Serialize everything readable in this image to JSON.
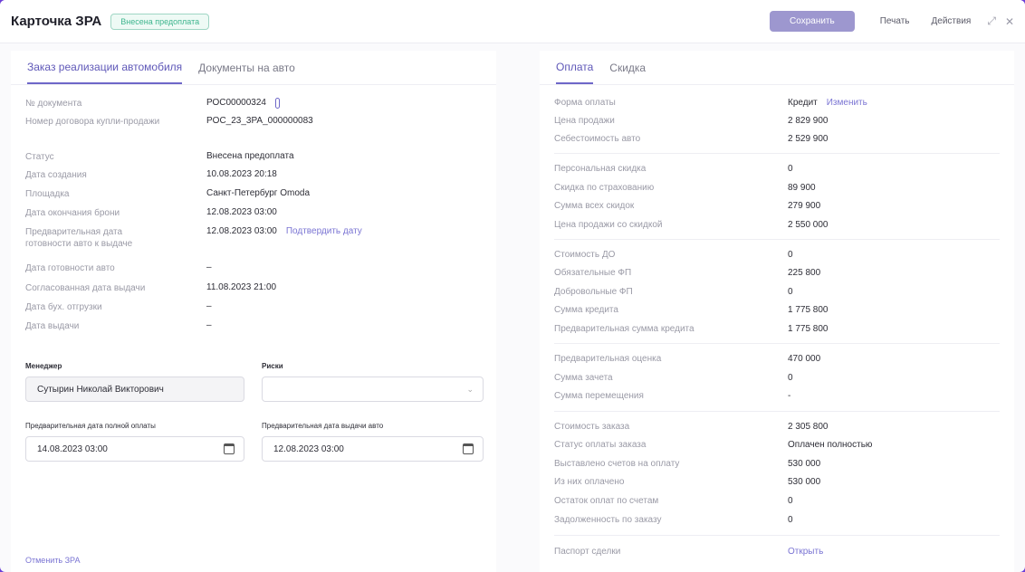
{
  "header": {
    "title": "Карточка ЗРА",
    "status_badge": "Внесена предоплата",
    "save_label": "Сохранить",
    "print_label": "Печать",
    "actions_label": "Действия"
  },
  "left": {
    "tabs": [
      {
        "label": "Заказ реализации автомобиля"
      },
      {
        "label": "Документы на авто"
      }
    ],
    "fields": {
      "doc_no": {
        "label": "№ документа",
        "value": "РОС00000324"
      },
      "contract_no": {
        "label": "Номер договора купли-продажи",
        "value": "POC_23_3PA_000000083"
      },
      "status": {
        "label": "Статус",
        "value": "Внесена предоплата"
      },
      "created": {
        "label": "Дата создания",
        "value": "10.08.2023 20:18"
      },
      "site": {
        "label": "Площадка",
        "value": "Санкт-Петербург Omoda"
      },
      "reserve_end": {
        "label": "Дата окончания брони",
        "value": "12.08.2023 03:00"
      },
      "prelim_ready": {
        "label": "Предварительная дата готовности авто к выдаче",
        "value": "12.08.2023 03:00",
        "link": "Подтвердить дату"
      },
      "ready": {
        "label": "Дата готовности авто",
        "value": "–"
      },
      "agreed_issue": {
        "label": "Согласованная дата выдачи",
        "value": "11.08.2023 21:00"
      },
      "acc_ship": {
        "label": "Дата бух. отгрузки",
        "value": "–"
      },
      "issue": {
        "label": "Дата выдачи",
        "value": "–"
      }
    },
    "manager": {
      "label": "Менеджер",
      "value": "Сутырин Николай Викторович"
    },
    "risks": {
      "label": "Риски",
      "value": ""
    },
    "full_pay_date": {
      "label": "Предварительная дата полной оплаты",
      "value": "14.08.2023 03:00"
    },
    "issue_date": {
      "label": "Предварительная дата выдачи авто",
      "value": "12.08.2023 03:00"
    },
    "cancel_link": "Отменить ЗРА"
  },
  "right": {
    "tabs": [
      {
        "label": "Оплата"
      },
      {
        "label": "Скидка"
      }
    ],
    "change_link": "Изменить",
    "rows": [
      {
        "label": "Форма оплаты",
        "value": "Кредит"
      },
      {
        "label": "Цена продажи",
        "value": "2 829 900"
      },
      {
        "label": "Себестоимость авто",
        "value": "2 529 900"
      },
      {
        "label": "Персональная скидка",
        "value": "0"
      },
      {
        "label": "Скидка по страхованию",
        "value": "89 900"
      },
      {
        "label": "Сумма всех скидок",
        "value": "279 900"
      },
      {
        "label": "Цена продажи со скидкой",
        "value": "2 550 000"
      },
      {
        "label": "Стоимость ДО",
        "value": "0"
      },
      {
        "label": "Обязательные ФП",
        "value": "225 800"
      },
      {
        "label": "Добровольные ФП",
        "value": "0"
      },
      {
        "label": "Сумма кредита",
        "value": "1 775 800"
      },
      {
        "label": "Предварительная сумма кредита",
        "value": "1 775 800"
      },
      {
        "label": "Предварительная оценка",
        "value": "470 000"
      },
      {
        "label": "Сумма зачета",
        "value": "0"
      },
      {
        "label": "Сумма перемещения",
        "value": "-"
      },
      {
        "label": "Стоимость заказа",
        "value": "2 305 800"
      },
      {
        "label": "Статус оплаты заказа",
        "value": "Оплачен полностью"
      },
      {
        "label": "Выставлено счетов на оплату",
        "value": "530 000"
      },
      {
        "label": "Из них оплачено",
        "value": "530 000"
      },
      {
        "label": "Остаток оплат по счетам",
        "value": "0"
      },
      {
        "label": "Задолженность по заказу",
        "value": "0"
      },
      {
        "label": "Паспорт сделки",
        "value": "Открыть"
      }
    ]
  }
}
